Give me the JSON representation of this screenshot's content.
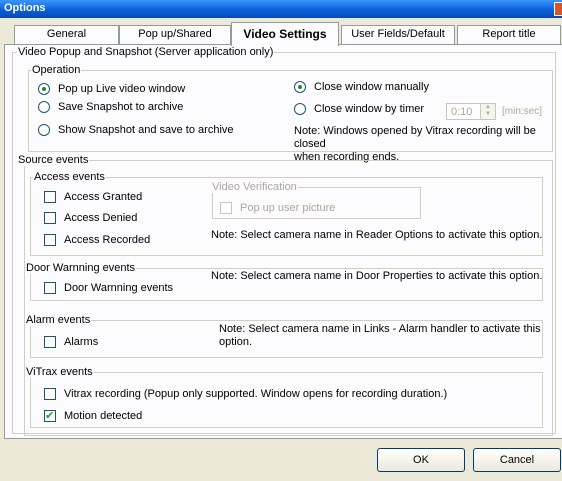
{
  "window": {
    "title": "Options"
  },
  "tabs": [
    {
      "label": "General"
    },
    {
      "label": "Pop up/Shared"
    },
    {
      "label": "Video Settings"
    },
    {
      "label": "User Fields/Default"
    },
    {
      "label": "Report title"
    }
  ],
  "video_group": {
    "legend": "Video Popup and Snapshot  (Server application only)"
  },
  "operation": {
    "legend": "Operation",
    "radios": [
      {
        "label": "Pop up Live video window",
        "checked": true
      },
      {
        "label": "Save Snapshot to archive",
        "checked": false
      },
      {
        "label": "Show Snapshot and save to  archive",
        "checked": false
      }
    ],
    "close_radios": [
      {
        "label": "Close window manually",
        "checked": true
      },
      {
        "label": "Close window by timer",
        "checked": false
      }
    ],
    "timer_value": "0:10",
    "timer_unit": "[min:sec]",
    "note_line1": "Note: Windows opened by Vitrax recording will be closed",
    "note_line2": "when recording ends."
  },
  "source_events": {
    "legend": "Source events"
  },
  "access_events": {
    "legend": "Access events",
    "checks": [
      {
        "label": "Access Granted",
        "checked": false
      },
      {
        "label": "Access Denied",
        "checked": false
      },
      {
        "label": "Access Recorded",
        "checked": false
      }
    ],
    "video_verification": {
      "legend": "Video Verification",
      "check_label": "Pop up user picture"
    },
    "note": "Note: Select camera name in Reader Options to activate this option."
  },
  "door_events": {
    "legend": "Door Warnning events",
    "check_label": "Door Warnning events",
    "note": "Note: Select camera name in Door Properties to activate this option."
  },
  "alarm_events": {
    "legend": "Alarm events",
    "check_label": "Alarms",
    "note_line1": "Note: Select camera name in Links - Alarm handler to activate this",
    "note_line2": "option."
  },
  "vitrax_events": {
    "legend": "ViTrax events",
    "checks": [
      {
        "label": "Vitrax recording (Popup only supported. Window opens for recording duration.)",
        "checked": false
      },
      {
        "label": "Motion detected",
        "checked": true
      }
    ]
  },
  "buttons": {
    "ok": "OK",
    "cancel": "Cancel"
  }
}
